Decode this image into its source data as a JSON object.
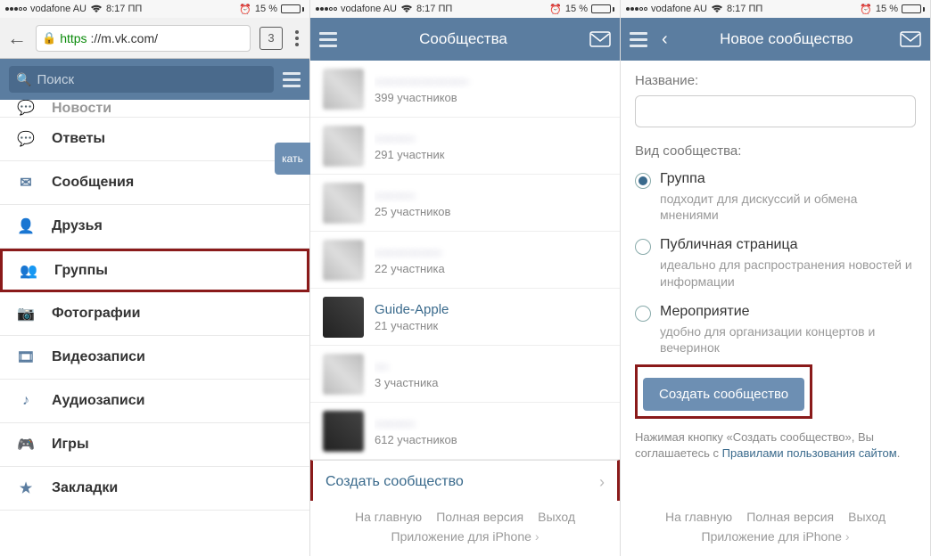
{
  "statusbar": {
    "carrier": "vodafone AU",
    "time": "8:17 ПП",
    "battery_pct": "15 %"
  },
  "browser": {
    "url_https": "https",
    "url_rest": "://m.vk.com/",
    "tab_count": "3"
  },
  "search": {
    "placeholder": "Поиск"
  },
  "menu": {
    "items": [
      {
        "label": "Новости",
        "icon": "chat"
      },
      {
        "label": "Ответы",
        "icon": "chat"
      },
      {
        "label": "Сообщения",
        "icon": "mail"
      },
      {
        "label": "Друзья",
        "icon": "person"
      },
      {
        "label": "Группы",
        "icon": "people"
      },
      {
        "label": "Фотографии",
        "icon": "camera"
      },
      {
        "label": "Видеозаписи",
        "icon": "video"
      },
      {
        "label": "Аудиозаписи",
        "icon": "music"
      },
      {
        "label": "Игры",
        "icon": "game"
      },
      {
        "label": "Закладки",
        "icon": "star"
      }
    ]
  },
  "edge_badge": "кать",
  "pane2": {
    "header_title": "Сообщества",
    "communities": [
      {
        "title": "———————",
        "sub": "399 участников",
        "blur": true
      },
      {
        "title": "———",
        "sub": "291 участник",
        "blur": true
      },
      {
        "title": "———",
        "sub": "25 участников",
        "blur": true
      },
      {
        "title": "—————",
        "sub": "22 участника",
        "blur": true
      },
      {
        "title": "Guide-Apple",
        "sub": "21 участник",
        "blur": false,
        "dark": true
      },
      {
        "title": "—",
        "sub": "3 участника",
        "blur": true
      },
      {
        "title": "———",
        "sub": "612 участников",
        "blur": true,
        "dark": true
      }
    ],
    "create_label": "Создать сообщество"
  },
  "pane3": {
    "header_title": "Новое сообщество",
    "name_label": "Название:",
    "type_label": "Вид сообщества:",
    "options": [
      {
        "title": "Группа",
        "desc": "подходит для дискуссий и обмена мнениями",
        "checked": true
      },
      {
        "title": "Публичная страница",
        "desc": "идеально для распространения новостей и информации",
        "checked": false
      },
      {
        "title": "Мероприятие",
        "desc": "удобно для организации концертов и вечеринок",
        "checked": false
      }
    ],
    "create_btn": "Создать сообщество",
    "terms_pre": "Нажимая кнопку «Создать сообщество», Вы соглашаетесь с ",
    "terms_link": "Правилами пользования сайтом",
    "terms_post": "."
  },
  "footer": {
    "home": "На главную",
    "full": "Полная версия",
    "exit": "Выход",
    "app": "Приложение для iPhone"
  }
}
